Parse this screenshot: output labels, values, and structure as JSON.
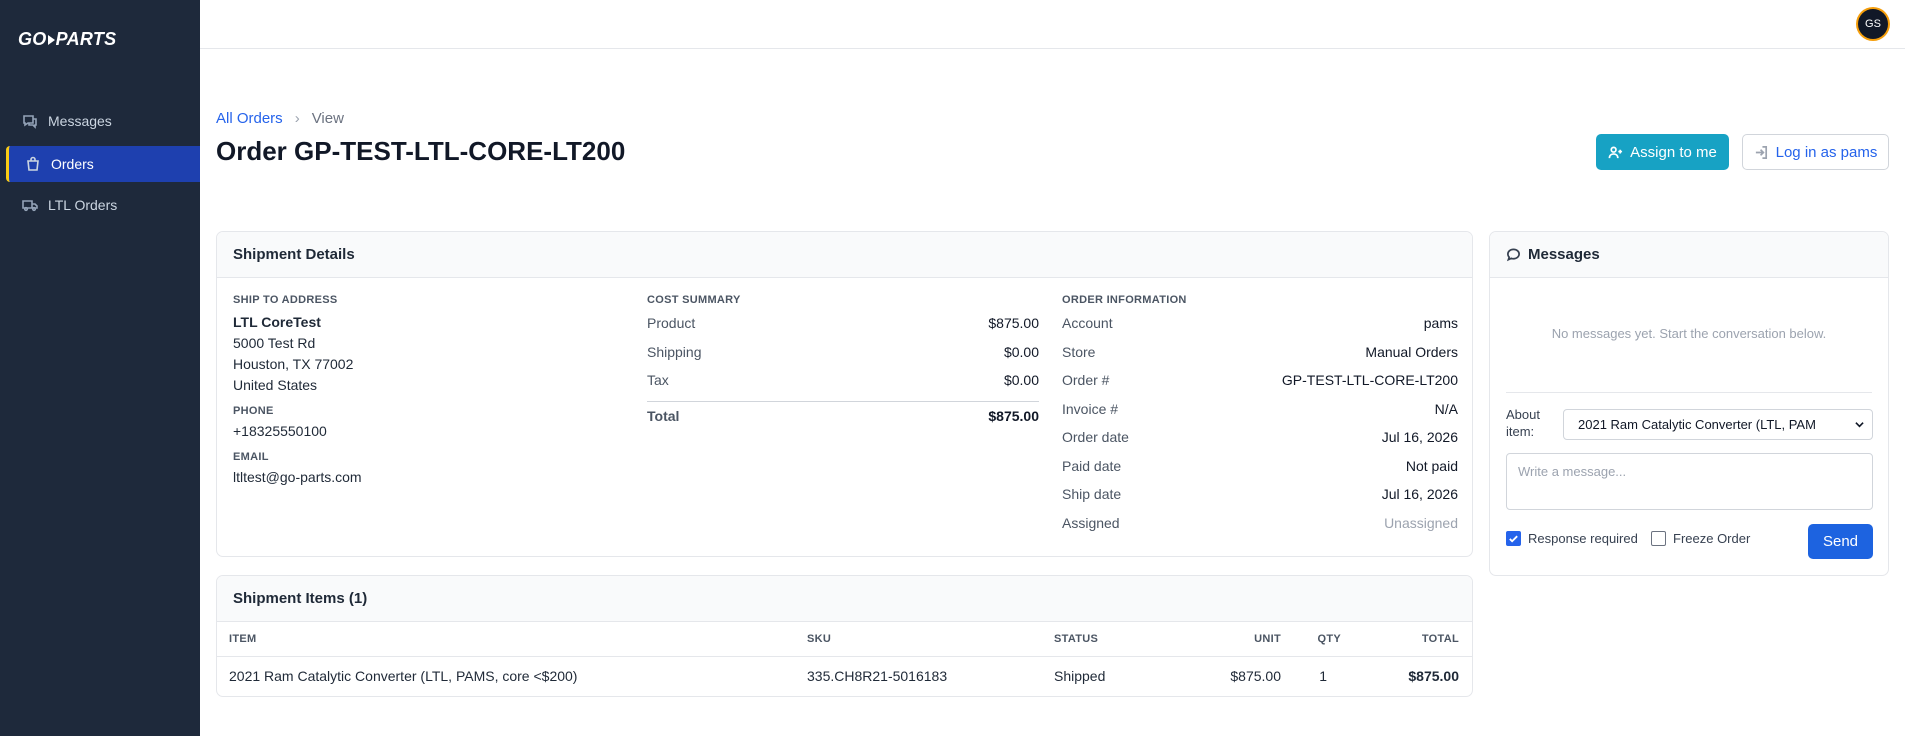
{
  "brand": {
    "logo_left": "GO",
    "logo_right": "PARTS"
  },
  "sidebar": {
    "items": [
      {
        "label": "Messages",
        "icon": "chat-icon"
      },
      {
        "label": "Orders",
        "icon": "bag-icon",
        "active": true
      },
      {
        "label": "LTL Orders",
        "icon": "truck-icon"
      }
    ]
  },
  "topbar": {
    "avatar_initials": "GS"
  },
  "header": {
    "breadcrumb_root": "All Orders",
    "breadcrumb_current": "View",
    "title": "Order GP-TEST-LTL-CORE-LT200",
    "assign_label": "Assign to me",
    "login_label": "Log in as pams"
  },
  "shipment": {
    "title": "Shipment Details",
    "ship_to": {
      "label": "SHIP TO ADDRESS",
      "name": "LTL CoreTest",
      "street": "5000 Test Rd",
      "city": "Houston, TX 77002",
      "country": "United States",
      "phone_label": "PHONE",
      "phone": "+18325550100",
      "email_label": "EMAIL",
      "email": "ltltest@go-parts.com"
    },
    "cost": {
      "label": "COST SUMMARY",
      "rows": [
        {
          "k": "Product",
          "v": "$875.00"
        },
        {
          "k": "Shipping",
          "v": "$0.00"
        },
        {
          "k": "Tax",
          "v": "$0.00"
        }
      ],
      "total_label": "Total",
      "total": "$875.00"
    },
    "order_info": {
      "label": "ORDER INFORMATION",
      "rows": [
        {
          "k": "Account",
          "v": "pams"
        },
        {
          "k": "Store",
          "v": "Manual Orders"
        },
        {
          "k": "Order #",
          "v": "GP-TEST-LTL-CORE-LT200"
        },
        {
          "k": "Invoice #",
          "v": "N/A"
        },
        {
          "k": "Order date",
          "v": "Jul 16, 2026"
        },
        {
          "k": "Paid date",
          "v": "Not paid"
        },
        {
          "k": "Ship date",
          "v": "Jul 16, 2026"
        },
        {
          "k": "Assigned",
          "v": "Unassigned"
        }
      ]
    }
  },
  "items": {
    "title": "Shipment Items (1)",
    "columns": [
      "ITEM",
      "SKU",
      "STATUS",
      "UNIT",
      "QTY",
      "TOTAL"
    ],
    "rows": [
      {
        "item": "2021 Ram Catalytic Converter (LTL, PAMS, core <$200)",
        "sku": "335.CH8R21-5016183",
        "status": "Shipped",
        "unit": "$875.00",
        "qty": "1",
        "total": "$875.00"
      }
    ]
  },
  "messages": {
    "title": "Messages",
    "empty": "No messages yet. Start the conversation below.",
    "about_label": "About item:",
    "about_value": "2021 Ram Catalytic Converter (LTL, PAM",
    "placeholder": "Write a message...",
    "response_required_label": "Response required",
    "response_required": true,
    "freeze_label": "Freeze Order",
    "freeze": false,
    "send_label": "Send"
  },
  "colors": {
    "sidebar": "#1e293b",
    "active_nav": "#1e40af",
    "accent": "#17a2c4",
    "primary": "#1d63e0"
  }
}
